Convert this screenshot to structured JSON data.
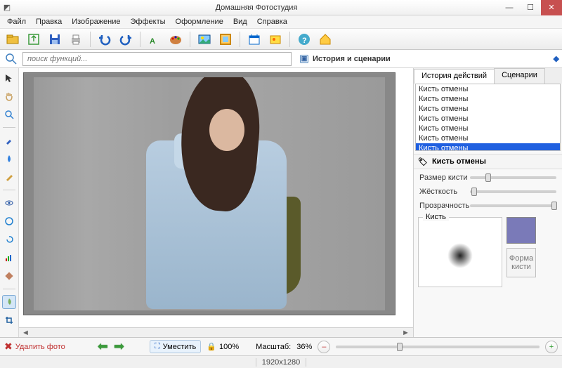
{
  "window": {
    "title": "Домашняя Фотостудия"
  },
  "menu": {
    "file": "Файл",
    "edit": "Правка",
    "image": "Изображение",
    "effects": "Эффекты",
    "design": "Оформление",
    "view": "Вид",
    "help": "Справка"
  },
  "search": {
    "placeholder": "поиск функций..."
  },
  "right": {
    "panel_title": "История и сценарии",
    "tab_history": "История действий",
    "tab_scenarios": "Сценарии",
    "history_items": {
      "i0": "Кисть отмены",
      "i1": "Кисть отмены",
      "i2": "Кисть отмены",
      "i3": "Кисть отмены",
      "i4": "Кисть отмены",
      "i5": "Кисть отмены",
      "i6": "Кисть отмены"
    },
    "section_title": "Кисть отмены",
    "label_size": "Размер кисти",
    "label_hardness": "Жёсткость",
    "label_opacity": "Прозрачность",
    "brush_label": "Кисть",
    "shape_label": "Форма кисти",
    "brush_color": "#7a7ab8"
  },
  "bottom": {
    "delete": "Удалить фото",
    "fit": "Уместить",
    "lock_zoom": "100%",
    "scale_label": "Масштаб:",
    "scale_value": "36%"
  },
  "status": {
    "dims": "1920x1280"
  }
}
